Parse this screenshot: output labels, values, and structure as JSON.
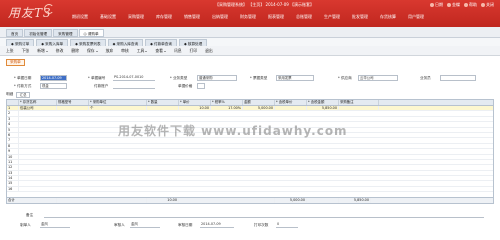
{
  "app": {
    "logo_text": "用友T3",
    "status_line": "【采购管理系统】 【主页】 2014-07-09 【演示账套】",
    "window_controls": [
      "日期",
      "金蝶",
      "帮助",
      "关闭"
    ]
  },
  "menu": [
    "期初设置",
    "基础设置",
    "采购管理",
    "库存管理",
    "销售管理",
    "出纳管理",
    "财务管理",
    "报表管理",
    "总账管理",
    "生产管理",
    "批发管理",
    "存货核算",
    "用户管理"
  ],
  "tabs": [
    {
      "label": "首页",
      "active": false
    },
    {
      "label": "初始化管理",
      "active": false
    },
    {
      "label": "采购管理",
      "active": false
    },
    {
      "label": "◎ 请购单",
      "active": true
    }
  ],
  "subtabs": [
    "◆ 采购订单",
    "◆ 采购入库单",
    "◆ 采购发票列表",
    "◆ 采购入库查询",
    "◆ 付款单查询",
    "◆ 核算处理"
  ],
  "toolbar": [
    "上张",
    "下张",
    "新增",
    "修改",
    "删除",
    "保存",
    "放弃",
    "审核",
    "工具",
    "查看",
    "讯息",
    "打印",
    "退出"
  ],
  "doc_title": "采购单",
  "header": {
    "doc_date_label": "* 单据日期",
    "doc_date_value": "2014-07-09",
    "doc_no_label": "* 单据编号",
    "doc_no_value": "PS-2014-07-0010",
    "biz_type_label": "* 业务类型",
    "biz_type_value": "普通采购",
    "note_type_label": "* 票据类型",
    "note_type_value": "采用发票",
    "supplier_label": "* 供应商",
    "supplier_value": "云华公司",
    "buyer_label": "业务员",
    "buyer_value": "",
    "pay_method_label": "* 付款方式",
    "pay_method_value": "现金",
    "pay_account_label": "付款账户",
    "pay_account_value": "",
    "invoice_label": "单据价格",
    "invoice_value": ""
  },
  "detail_label": "明细",
  "detail_btn": "汇总",
  "grid": {
    "columns": [
      "* 存货名称",
      "规格型号",
      "* 采购单位",
      "* 数量",
      "* 单价",
      "* 税率%",
      "金额",
      "* 含税单价",
      "* 含税金额",
      "采购备注"
    ],
    "rows": [
      [
        "包装公司",
        "个",
        "",
        "",
        "10.00",
        "17.00%",
        "5,000.00",
        "",
        "5,850.00",
        ""
      ]
    ],
    "total_label": "合计",
    "total_qty": "10.00",
    "total_amount": "5,000.00",
    "total_tax_amount": "5,850.00"
  },
  "watermark": "用友软件下载 www.ufidawhy.com",
  "footer": {
    "note_label": "备注",
    "maker_label": "制单人",
    "maker_value": "金凤",
    "auditor_label": "审核人",
    "auditor_value": "金凤",
    "audit_date_label": "审核日期",
    "audit_date_value": "2014-07-09",
    "print_count_label": "打印次数",
    "print_count_value": "0"
  },
  "colors": {
    "banner": "#c92c24",
    "accent": "#3f6fc6",
    "tag": "#d05a10"
  }
}
